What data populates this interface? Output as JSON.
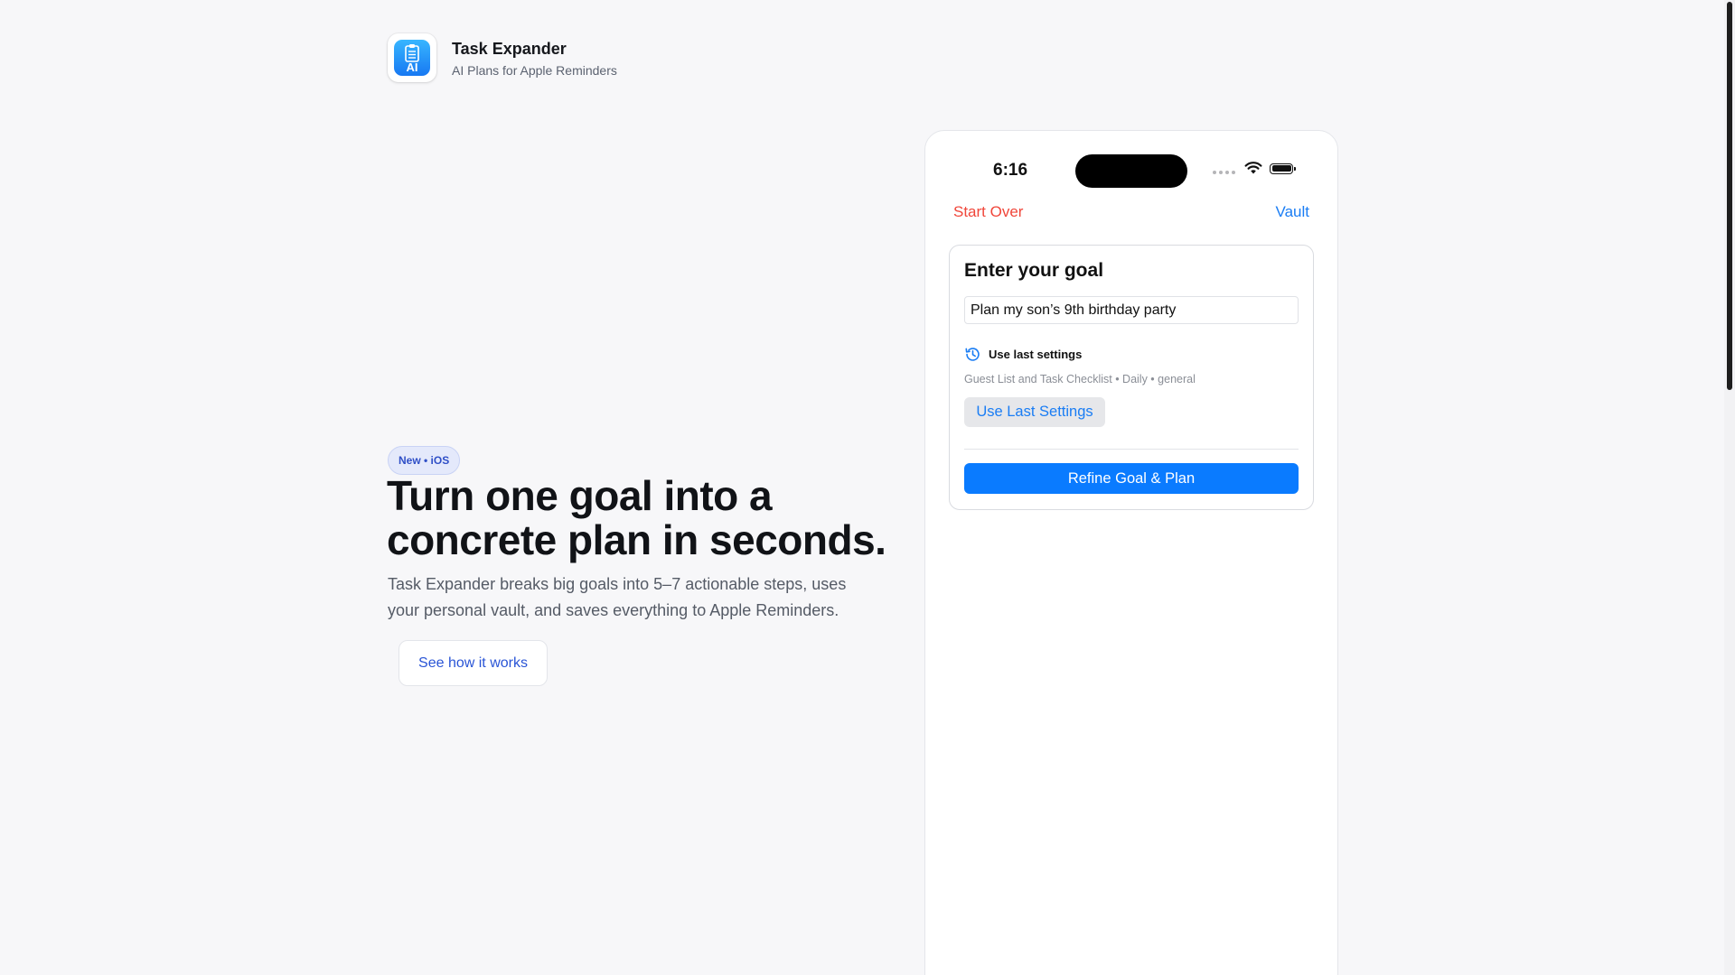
{
  "brand": {
    "title": "Task Expander",
    "subtitle": "AI Plans for Apple Reminders",
    "icon_text": "AI",
    "icon_name": "checklist-ai-app-icon"
  },
  "hero": {
    "badge": "New • iOS",
    "title_line1": "Turn one goal into a",
    "title_line2": "concrete plan in seconds.",
    "description_line1": "Task Expander breaks big goals into 5–7 actionable steps, uses",
    "description_line2": "your personal vault, and saves everything to Apple Reminders.",
    "cta_label": "See how it works"
  },
  "phone": {
    "status": {
      "time": "6:16",
      "icons": [
        "signal-icon",
        "wifi-icon",
        "battery-icon"
      ]
    },
    "nav": {
      "left_label": "Start Over",
      "right_label": "Vault"
    },
    "goal_card": {
      "title": "Enter your goal",
      "input_value": "Plan my son’s 9th birthday party",
      "last_settings_label": "Use last settings",
      "settings_summary": "Guest List and Task Checklist • Daily • general",
      "use_last_button": "Use Last Settings",
      "refine_button": "Refine Goal & Plan"
    }
  },
  "colors": {
    "background": "#f7f7f9",
    "accent_blue": "#0a7bff",
    "destructive_red": "#f0463a",
    "link_blue": "#2a55d6",
    "badge_bg": "#e4e9fb"
  }
}
